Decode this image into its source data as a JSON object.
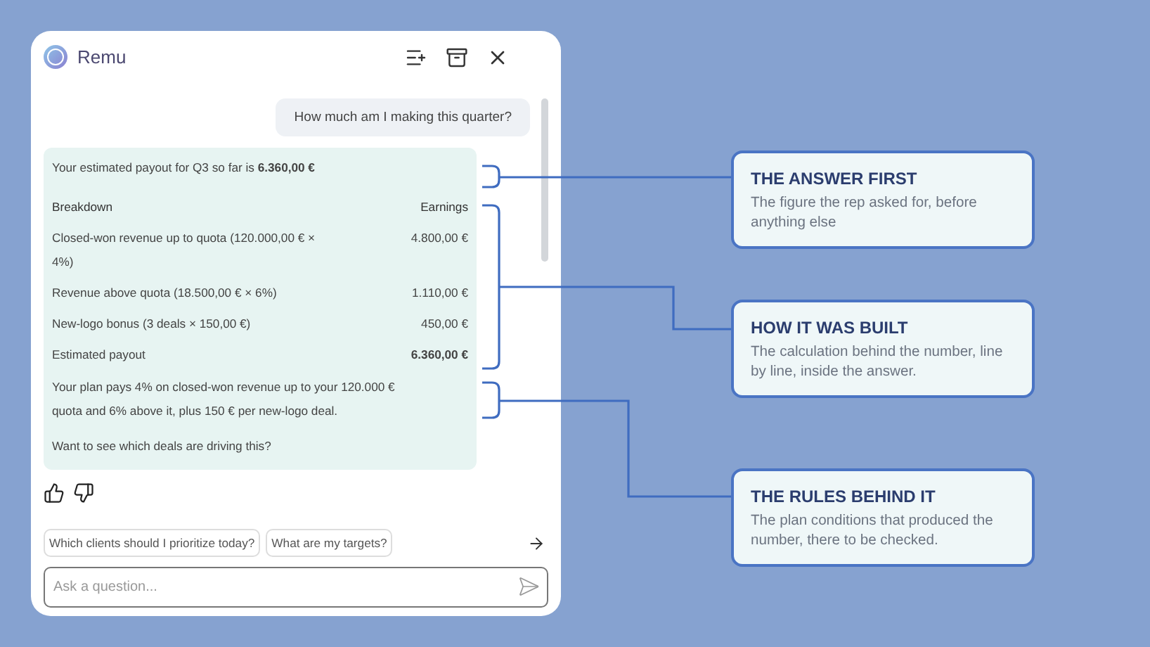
{
  "app": {
    "title": "Remu"
  },
  "conversation": {
    "user_message": "How much am I making this quarter?",
    "answer": {
      "summary": "Your estimated payout for Q3 so far is **6.360,00 €**",
      "table": {
        "columns": [
          "Breakdown",
          "Earnings"
        ],
        "rows": [
          {
            "label": "Closed-won revenue up to quota (120.000,00 € × 4%)",
            "amount": "4.800,00 €",
            "kind": "line"
          },
          {
            "label": "Revenue above quota (18.500,00 € × 6%)",
            "amount": "1.110,00 €",
            "kind": "line"
          },
          {
            "label": "New-logo bonus (3 deals × 150,00 €)",
            "amount": "450,00 €",
            "kind": "line"
          },
          {
            "label": "Estimated payout",
            "amount": "6.360,00 €",
            "kind": "total"
          }
        ]
      },
      "explanation": "Your plan pays 4% on closed-won revenue up to your 120.000 € quota and 6% above it, plus 150 € per new-logo deal.",
      "follow_up": "Want to see which deals are driving this?"
    }
  },
  "suggestions": [
    "Which clients should I prioritize today?",
    "What are my targets?"
  ],
  "composer": {
    "placeholder": "Ask a question..."
  },
  "callouts": [
    {
      "title": "THE ANSWER FIRST",
      "text": "The figure the rep asked for, before anything else"
    },
    {
      "title": "HOW IT WAS BUILT",
      "text": "The calculation behind the number, line by line, inside the answer."
    },
    {
      "title": "THE RULES BEHIND IT",
      "text": "The plan conditions that produced the number, there to be checked."
    }
  ]
}
